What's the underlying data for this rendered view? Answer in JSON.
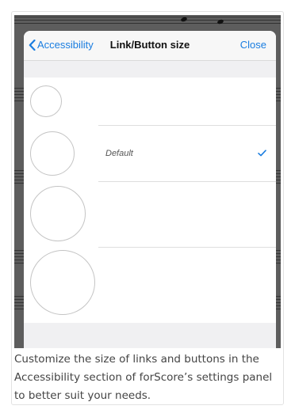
{
  "nav": {
    "back_label": "Accessibility",
    "title": "Link/Button size",
    "close_label": "Close"
  },
  "sizes": [
    {
      "label": "",
      "selected": false
    },
    {
      "label": "Default",
      "selected": true
    },
    {
      "label": "",
      "selected": false
    },
    {
      "label": "",
      "selected": false
    }
  ],
  "caption": "Customize the size of links and buttons in the Accessibility section of forScore’s settings panel to better suit your needs.",
  "colors": {
    "accent": "#1a7de0",
    "backdrop": "#5d5d5d",
    "group_background": "#f0f0f2"
  },
  "icons": {
    "back": "chevron-left-icon",
    "selected": "checkmark-icon"
  }
}
